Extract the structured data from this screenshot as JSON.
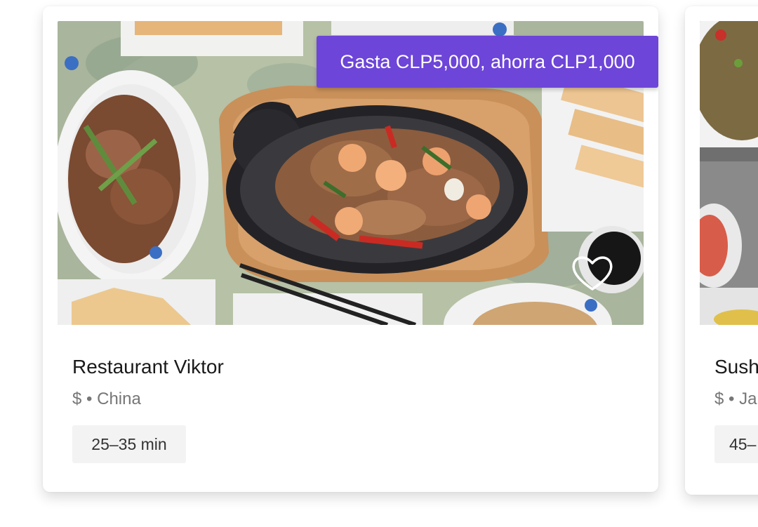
{
  "restaurants": [
    {
      "name": "Restaurant Viktor",
      "price": "$",
      "separator": "•",
      "cuisine": "China",
      "delivery_time": "25–35 min",
      "promo": "Gasta CLP5,000, ahorra CLP1,000",
      "favorite_icon": "heart-outline-icon"
    },
    {
      "name": "Sush",
      "price": "$",
      "separator": "•",
      "cuisine": "Ja",
      "delivery_time": "45–"
    }
  ],
  "colors": {
    "promo_badge": "#6d45d8",
    "card_background": "#ffffff",
    "time_pill": "#f3f3f3",
    "meta_text": "#767676"
  }
}
